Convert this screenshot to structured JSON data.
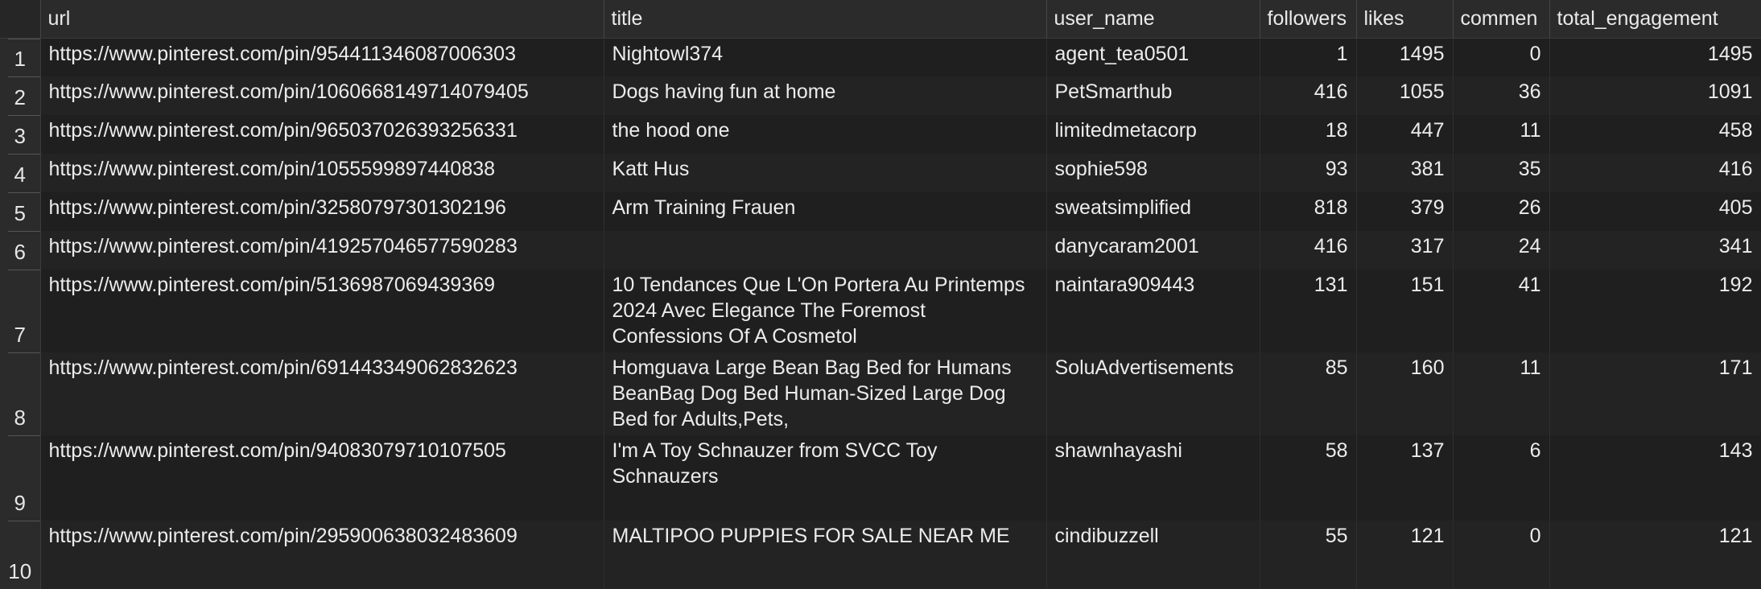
{
  "columns": [
    "url",
    "title",
    "user_name",
    "followers",
    "likes",
    "commen",
    "total_engagement"
  ],
  "rows": [
    {
      "index": "1",
      "url": "https://www.pinterest.com/pin/954411346087006303",
      "title": "Nightowl374",
      "user_name": "agent_tea0501",
      "followers": "1",
      "likes": "1495",
      "comments": "0",
      "total_engagement": "1495"
    },
    {
      "index": "2",
      "url": "https://www.pinterest.com/pin/1060668149714079405",
      "title": "Dogs having fun at  home",
      "user_name": "PetSmarthub",
      "followers": "416",
      "likes": "1055",
      "comments": "36",
      "total_engagement": "1091"
    },
    {
      "index": "3",
      "url": "https://www.pinterest.com/pin/965037026393256331",
      "title": "the hood one",
      "user_name": "limitedmetacorp",
      "followers": "18",
      "likes": "447",
      "comments": "11",
      "total_engagement": "458"
    },
    {
      "index": "4",
      "url": "https://www.pinterest.com/pin/1055599897440838",
      "title": "Katt Hus",
      "user_name": "sophie598",
      "followers": "93",
      "likes": "381",
      "comments": "35",
      "total_engagement": "416"
    },
    {
      "index": "5",
      "url": "https://www.pinterest.com/pin/32580797301302196",
      "title": "Arm Training Frauen",
      "user_name": "sweatsimplified",
      "followers": "818",
      "likes": "379",
      "comments": "26",
      "total_engagement": "405"
    },
    {
      "index": "6",
      "url": "https://www.pinterest.com/pin/419257046577590283",
      "title": "",
      "user_name": "danycaram2001",
      "followers": "416",
      "likes": "317",
      "comments": "24",
      "total_engagement": "341"
    },
    {
      "index": "7",
      "url": "https://www.pinterest.com/pin/5136987069439369",
      "title": "10 Tendances Que L'On Portera Au Printemps 2024 Avec Elegance The Foremost Confessions Of A Cosmetol",
      "user_name": "naintara909443",
      "followers": "131",
      "likes": "151",
      "comments": "41",
      "total_engagement": "192"
    },
    {
      "index": "8",
      "url": "https://www.pinterest.com/pin/691443349062832623",
      "title": "Homguava Large Bean Bag Bed for Humans BeanBag Dog Bed Human-Sized Large Dog Bed for Adults,Pets,",
      "user_name": "SoluAdvertisements",
      "followers": "85",
      "likes": "160",
      "comments": "11",
      "total_engagement": "171"
    },
    {
      "index": "9",
      "url": "https://www.pinterest.com/pin/94083079710107505",
      "title": "I'm A Toy Schnauzer from SVCC Toy Schnauzers",
      "user_name": "shawnhayashi",
      "followers": "58",
      "likes": "137",
      "comments": "6",
      "total_engagement": "143"
    },
    {
      "index": "10",
      "url": "https://www.pinterest.com/pin/295900638032483609",
      "title": "MALTIPOO PUPPIES FOR SALE NEAR ME",
      "user_name": "cindibuzzell",
      "followers": "55",
      "likes": "121",
      "comments": "0",
      "total_engagement": "121"
    }
  ]
}
